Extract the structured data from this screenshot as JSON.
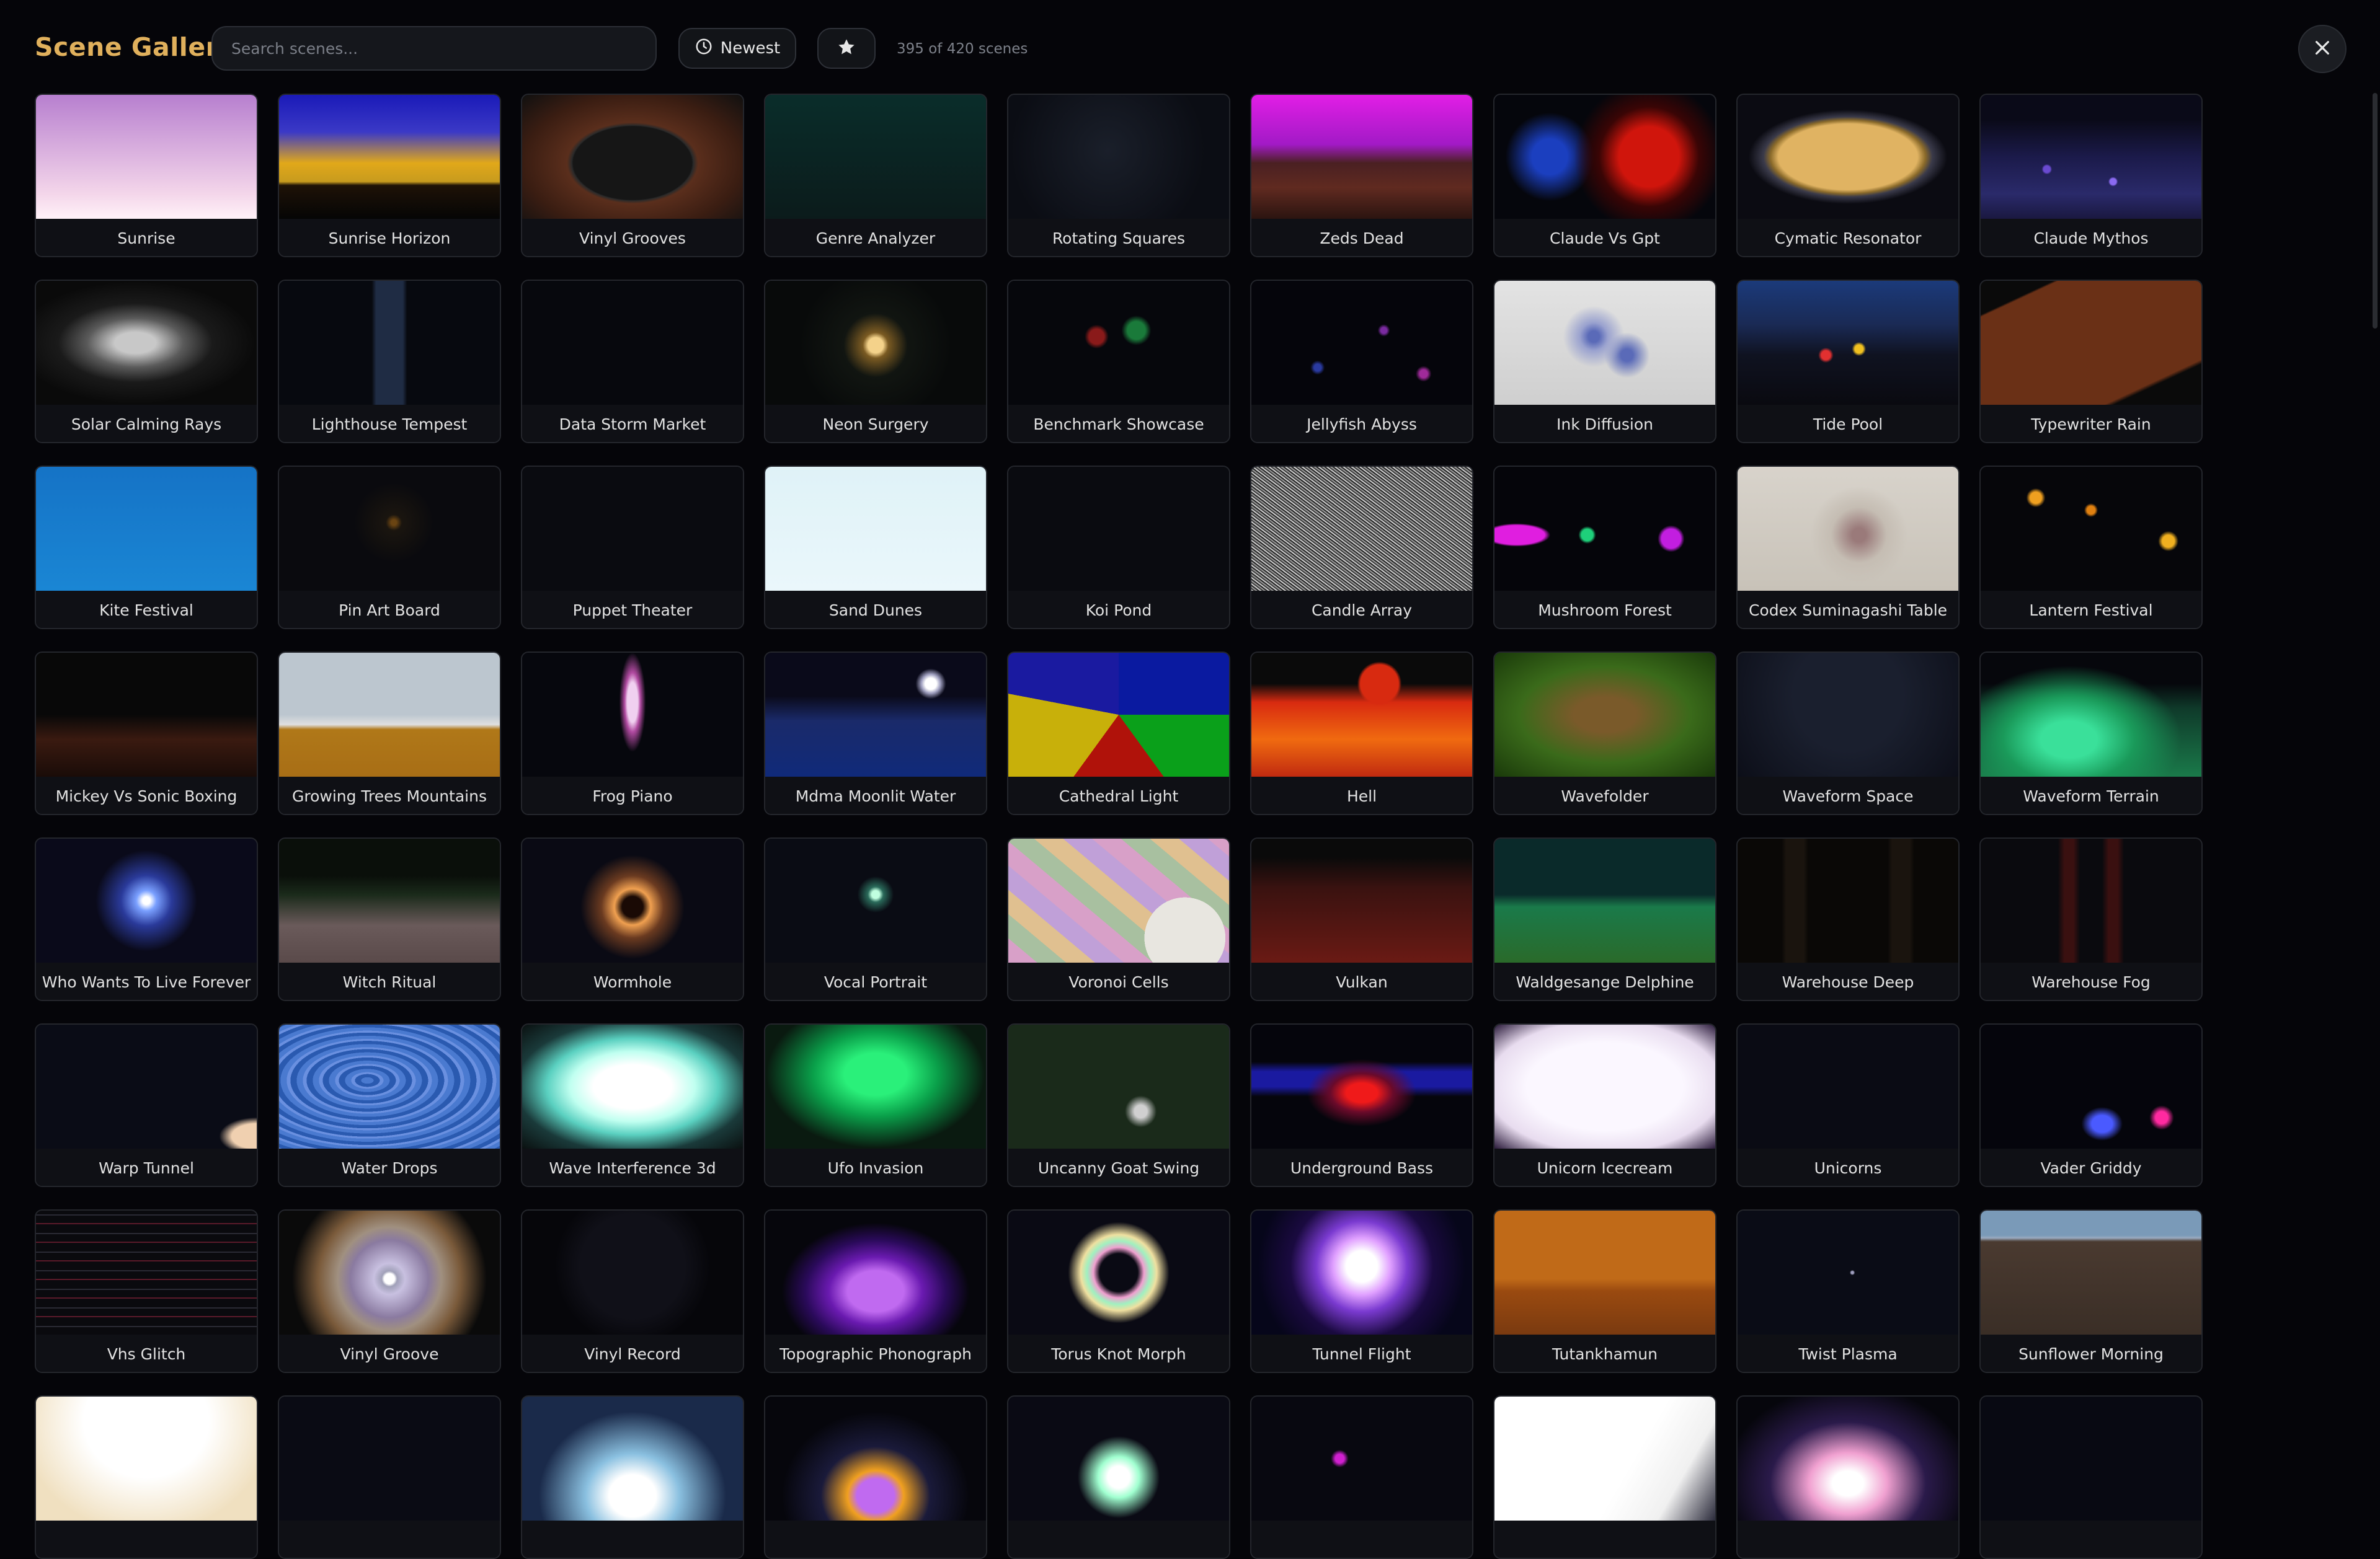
{
  "header": {
    "title": "Scene Gallery",
    "search_placeholder": "Search scenes...",
    "sort_label": "Newest",
    "count_text": "395 of 420 scenes"
  },
  "icons": {
    "sort": "clock-icon",
    "favorites": "star-icon",
    "close": "close-icon"
  },
  "scenes": [
    {
      "name": "Sunrise",
      "bg": "linear-gradient(#b77fcf,#f4d6ea 80%,#fff2f8)"
    },
    {
      "name": "Sunrise Horizon",
      "bg": "linear-gradient(#1a1ab8 0%,#3b39c6 30%,#e1a81a 55%,#c79b1e 70%,#1e1206 73%,#050505 100%)"
    },
    {
      "name": "Vinyl Grooves",
      "bg": "radial-gradient(ellipse at 50% 55%,#161616 0 38%,#2a2a2a 39%,#5a2e1c 42%,#3a1d12 70%,#101010 100%)"
    },
    {
      "name": "Genre Analyzer",
      "bg": "linear-gradient(#0a2d2a,#0b1b1b)"
    },
    {
      "name": "Rotating Squares",
      "bg": "radial-gradient(circle at 45% 45%,#1a1f2a,#0b0d14 70%)"
    },
    {
      "name": "Zeds Dead",
      "bg": "linear-gradient(#e21ee6 0%,#a21ac6 40%,#4a2022 55%,#602a20 75%,#2b1410 100%)"
    },
    {
      "name": "Claude Vs Gpt",
      "bg": "radial-gradient(circle at 70% 50%,#d0150c 0 18%,#3a0505 30%,transparent 45%),radial-gradient(circle at 25% 50%,#1b3fbf 0 10%,transparent 25%),#05060c"
    },
    {
      "name": "Cymatic Resonator",
      "bg": "radial-gradient(ellipse 45% 38% at 50% 50%,#e0b362 0 70%,#8a6a2a 78%,#3a3a4a 85%,#0b0b12 100%)"
    },
    {
      "name": "Claude Mythos",
      "bg": "radial-gradient(circle at 30% 60%,#6a4ad0 0 2%,transparent 3%),radial-gradient(circle at 60% 70%,#8a6af0 0 2%,transparent 3%),linear-gradient(#0a0a18 0 20%,#1b1a4a 50%,#2a2a6a 80%,#1a1840 100%)"
    },
    {
      "name": "Solar Calming Rays",
      "bg": "radial-gradient(ellipse at 45% 50%,#c8c8c8 0 12%,#5a5a5a 28%,#1a1a1a 45%,#0a0a0a 70%)"
    },
    {
      "name": "Lighthouse Tempest",
      "bg": "linear-gradient(90deg,#07090f 0 42%,#1f2c44 44% 56%,#07090f 58%)"
    },
    {
      "name": "Data Storm Market",
      "bg": "#07080d"
    },
    {
      "name": "Neon Surgery",
      "bg": "radial-gradient(circle at 50% 52%,#f4d28a 0 6%,#7a5a22 10%,#111511 25%,#080a0a 60%)"
    },
    {
      "name": "Benchmark Showcase",
      "bg": "radial-gradient(circle at 40% 45%,#8a1a1a 0 5%,transparent 8%),radial-gradient(circle at 58% 40%,#1a7a3a 0 6%,transparent 10%),#06070c"
    },
    {
      "name": "Jellyfish Abyss",
      "bg": "radial-gradient(circle at 60% 40%,#7a2aa0 0 2%,transparent 4%),radial-gradient(circle at 30% 70%,#2a3aa0 0 2%,transparent 4%),radial-gradient(circle at 78% 75%,#a02a9a 0 2%,transparent 4%),#05050b"
    },
    {
      "name": "Ink Diffusion",
      "bg": "radial-gradient(circle at 45% 45%,#5a6ab8 0 4%,#9aa2cf 10%,transparent 22%),radial-gradient(circle at 60% 60%,#5a6ab8 0 4%,transparent 15%),linear-gradient(#e3e3e3,#cfcfcf)"
    },
    {
      "name": "Tide Pool",
      "bg": "radial-gradient(circle at 40% 60%,#e23030 0 3%,transparent 5%),radial-gradient(circle at 55% 55%,#f0c020 0 3%,transparent 5%),linear-gradient(#1b3a7a 0%,#1a2a55 35%,#0f1220 60%,#0a0a10 100%)"
    },
    {
      "name": "Typewriter Rain",
      "bg": "linear-gradient(155deg,#0a0a0a 0 15%,#6a3016 16% 80%,#0a0a0a 82%)"
    },
    {
      "name": "Kite Festival",
      "bg": "linear-gradient(#1573c6,#1a86d4)"
    },
    {
      "name": "Pin Art Board",
      "bg": "radial-gradient(circle at 52% 45%,#6a4412 0 2%,#1a150f 6%,#0a0a0e 30%)"
    },
    {
      "name": "Puppet Theater",
      "bg": "#0a0b10"
    },
    {
      "name": "Sand Dunes",
      "bg": "linear-gradient(#dff2f7,#eaf7fb)"
    },
    {
      "name": "Koi Pond",
      "bg": "#0a0b10"
    },
    {
      "name": "Candle Array",
      "bg": "repeating-linear-gradient(37deg,#cfcfcf 0 2px,#3a3a3a 2px 4px,#9a9a9a 4px 6px,#222 6px 8px)"
    },
    {
      "name": "Mushroom Forest",
      "bg": "radial-gradient(ellipse at 10% 55%,#e01ee0 0 10%,transparent 12%),radial-gradient(circle at 42% 55%,#1ed07a 0 4%,transparent 6%),radial-gradient(circle at 80% 58%,#c21ee0 0 5%,transparent 7%),#05050a"
    },
    {
      "name": "Codex Suminagashi Table",
      "bg": "radial-gradient(circle at 55% 55%,#9a7a7a 0 5%,#c5bdb3 20%,transparent 35%),linear-gradient(#d8d3cb,#c8c2b8)"
    },
    {
      "name": "Lantern Festival",
      "bg": "radial-gradient(circle at 25% 25%,#f0a020 0 3%,transparent 5%),radial-gradient(circle at 50% 35%,#e08010 0 3%,transparent 5%),radial-gradient(circle at 85% 60%,#f0b020 0 3%,transparent 5%),#06060a"
    },
    {
      "name": "Mickey Vs Sonic Boxing",
      "bg": "linear-gradient(#080808 0 50%,#3a1a10 70%,#1a0c08 100%)"
    },
    {
      "name": "Growing Trees Mountains",
      "bg": "linear-gradient(#bcc6cf 0 50%,#e0e0e0 58%,#b07818 62%,#a86e16 100%)"
    },
    {
      "name": "Frog Piano",
      "bg": "radial-gradient(ellipse 6% 40% at 50% 40%,#f0d0f0 0 40%,#b04aa0 60%,transparent 100%),#06070d"
    },
    {
      "name": "Mdma Moonlit Water",
      "bg": "radial-gradient(circle at 75% 25%,#ffffff 0 3%,#a0a0c0 5%,transparent 8%),linear-gradient(#0a0a1a 0 35%,#1a2a6a 55%,#102a7a 100%)"
    },
    {
      "name": "Cathedral Light",
      "bg": "conic-gradient(from 0deg at 50% 50%,#0a1aa0 0 25%,#0aa01a 25% 40%,#b0120a 40% 60%,#c8b00a 60% 78%,#1a1aa0 78% 100%)"
    },
    {
      "name": "Hell",
      "bg": "radial-gradient(circle at 58% 25%,#d82a10 0 12%,transparent 14%),linear-gradient(#0a0a0a 0 25%,#d82a10 40%,#f06a10 70%,#c02a10 100%)"
    },
    {
      "name": "Wavefolder",
      "bg": "radial-gradient(ellipse at 50% 50%,#7a5a2a 0 20%,#3a6a1a 55%,#1a3a0a 100%)"
    },
    {
      "name": "Waveform Space",
      "bg": "radial-gradient(circle at 50% 35%,#1a1f2e 0 40%,#0c0e18 100%)"
    },
    {
      "name": "Waveform Terrain",
      "bg": "radial-gradient(ellipse at 40% 70%,#3ae09a 0 15%,#1a9a5a 35%,transparent 60%),linear-gradient(#06070c 0 25%,#0f3a2a 45%,#1a7a4a 100%)"
    },
    {
      "name": "Who Wants To Live Forever",
      "bg": "radial-gradient(circle at 50% 50%,#ffffff 0 3%,#7aa0ff 8%,#2a3a9a 20%,#0a0a1a 40%)"
    },
    {
      "name": "Witch Ritual",
      "bg": "linear-gradient(#0a0f0a 0 30%,#1a2a1a 45%,#6a5a5a 70%,#5a4a4a 100%)"
    },
    {
      "name": "Wormhole",
      "bg": "radial-gradient(circle at 50% 55%,#1a0a05 0 8%,#f0a050 14%,#6a3a20 24%,#0a0a14 40%)"
    },
    {
      "name": "Vocal Portrait",
      "bg": "radial-gradient(circle at 50% 45%,#c0ffe0 0 3%,#2a6a5a 6%,#0a0c14 14%)"
    },
    {
      "name": "Voronoi Cells",
      "bg": "radial-gradient(circle at 80% 80%,#e8e6e0 0 20%,transparent 20%),repeating-linear-gradient(40deg,#d8a0c8 0 30px,#a8c0a0 30px 60px,#e0c090 60px 90px,#c0a0d8 90px 120px)"
    },
    {
      "name": "Vulkan",
      "bg": "linear-gradient(#0a0a0a 0 15%,#3a1210 40%,#6a1a14 100%)"
    },
    {
      "name": "Waldgesange Delphine",
      "bg": "linear-gradient(#0a2a2a 0 45%,#1a7a4a 55%,#2a6a2a 100%)"
    },
    {
      "name": "Warehouse Deep",
      "bg": "linear-gradient(90deg,#0a0806 0 20%,#1a140e 22% 30%,#0a0806 32% 68%,#1a140e 70% 78%,#0a0806 80%)"
    },
    {
      "name": "Warehouse Fog",
      "bg": "linear-gradient(90deg,#0a0a0e 0 35%,#3a1010 38% 42%,#0a0a0e 45% 55%,#3a1010 58% 62%,#0a0a0e 65%)"
    },
    {
      "name": "Warp Tunnel",
      "bg": "radial-gradient(ellipse at 100% 90%,#f0d0b0 0 8%,transparent 12%),#0a0c16"
    },
    {
      "name": "Water Drops",
      "bg": "repeating-radial-gradient(ellipse at 40% 45%,#4a7ad0 0 10px,#2a5ab0 10px 20px,#6a90e0 20px 26px)"
    },
    {
      "name": "Wave Interference 3d",
      "bg": "radial-gradient(ellipse at 50% 50%,#ffffff 0 25%,#c0fff0 40%,#5ad0c0 55%,#1a3a3a 75%,#0a1010 100%)"
    },
    {
      "name": "Ufo Invasion",
      "bg": "radial-gradient(ellipse at 50% 40%,#2af07a 0 20%,#0aa04a 40%,#0a1a10 70%)"
    },
    {
      "name": "Uncanny Goat Swing",
      "bg": "radial-gradient(circle at 60% 70%,#d0d0d0 0 4%,#1a2a1a 10%),radial-gradient(circle at 30% 25%,#f0f0f0 0 1.5%,transparent 3%),#0a120a"
    },
    {
      "name": "Underground Bass",
      "bg": "radial-gradient(ellipse at 50% 55%,#f01a1a 0 10%,#6a0a2a 20%,transparent 35%),linear-gradient(#05050c 0 30%,#1a1aa0 38% 50%,#05050c 58%)"
    },
    {
      "name": "Unicorn Icecream",
      "bg": "radial-gradient(ellipse at 50% 50%,#fbf7ff 0 50%,#e8dcef 75%,#2a1a3a 100%)"
    },
    {
      "name": "Unicorns",
      "bg": "#0a0b14"
    },
    {
      "name": "Vader Griddy",
      "bg": "radial-gradient(ellipse at 55% 80%,#4a5aff 0 6%,transparent 12%),radial-gradient(circle at 82% 75%,#ff2aa0 0 3%,transparent 6%),#05050c"
    },
    {
      "name": "Vhs Glitch",
      "bg": "repeating-linear-gradient(0deg,#0a0a0e 0 12px,#2a2a34 12px 14px,#0a0a0e 14px 28px,#5a1a2a 28px 30px)"
    },
    {
      "name": "Vinyl Groove",
      "bg": "radial-gradient(circle at 50% 55%,#ffffff 0 4%,#a0a0b8 6%,#c8c0e0 12%,#8a7aa0 30%,#a09080 40%,#7a5a3a 55%,#0a0a0a 75%)"
    },
    {
      "name": "Vinyl Record",
      "bg": "radial-gradient(circle at 50% 45%,#101018 0 40%,#06060a 60%)"
    },
    {
      "name": "Topographic Phonograph",
      "bg": "radial-gradient(ellipse at 50% 65%,#c06af0 0 18%,#6a1ab0 30%,#2a0a5a 45%,#06060c 60%)"
    },
    {
      "name": "Torus Knot Morph",
      "bg": "radial-gradient(circle at 50% 50%,#0a0a14 0 15%,#f0a0d0 20%,#a0f0c0 25%,#f0e0a0 30%,#0a0a14 40%)"
    },
    {
      "name": "Tunnel Flight",
      "bg": "radial-gradient(circle at 50% 45%,#ffffff 0 12%,#e0a0ff 22%,#7a3ad0 35%,#1a0a40 55%,#06061a 80%)"
    },
    {
      "name": "Tutankhamun",
      "bg": "linear-gradient(#c06a18 0 55%,#9a4a10 65%,#7a3a10 100%)"
    },
    {
      "name": "Twist Plasma",
      "bg": "radial-gradient(circle at 52% 50%,#a0a0c0 0 1%,transparent 2%),#0a0c16"
    },
    {
      "name": "Sunflower Morning",
      "bg": "linear-gradient(#7a9ab8 0 20%,#9aaac0 22%,#4a3a30 25%,#3a2e26 100%)"
    },
    {
      "name": "",
      "bg": "radial-gradient(ellipse at 50% 20%,#ffffff 0 40%,#f0e0c0 80%)"
    },
    {
      "name": "",
      "bg": "#0a0b14"
    },
    {
      "name": "",
      "bg": "radial-gradient(ellipse at 50% 80%,#ffffff 0 15%,#8ac0e0 30%,#1a2a4a 60%)"
    },
    {
      "name": "",
      "bg": "radial-gradient(ellipse at 50% 80%,#c06af0 0 12%,#f0a020 18%,#1a1a3a 35%,#06060c 60%)"
    },
    {
      "name": "",
      "bg": "radial-gradient(circle at 50% 65%,#ffffff 0 8%,#a0ffd0 15%,#0a0a14 30%)"
    },
    {
      "name": "",
      "bg": "radial-gradient(circle at 40% 50%,#d020d0 0 3%,transparent 6%),#080810"
    },
    {
      "name": "",
      "bg": "linear-gradient(120deg,#ffffff 0 60%,#f0f0f0 80%,#2a2a3a 100%)"
    },
    {
      "name": "",
      "bg": "radial-gradient(ellipse at 50% 70%,#ffffff 0 10%,#f0a0d0 25%,#2a1a4a 50%,#06060c 80%)"
    },
    {
      "name": "",
      "bg": "#080912"
    }
  ]
}
